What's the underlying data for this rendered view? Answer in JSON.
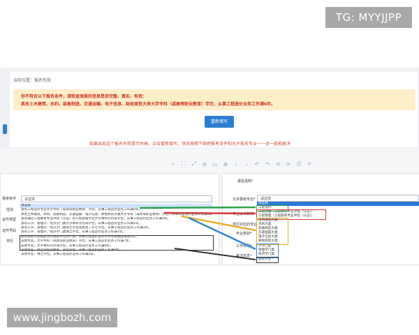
{
  "watermark_top": "TG: MYYJJPP",
  "watermark_bottom": "www.jingbozh.com",
  "breadcrumb": "当前位置：报名失败",
  "notice": {
    "line1": "你不符合以下报名条件，请检查填报的信息是否完整、真实、有效：",
    "line2": "具有土木建筑、水利、装备制造、交通运输、电子信息、财经商贸大类大学专科（或高等职业教育）学历，从事工程造价业务工作满6年。"
  },
  "refill_button": "重新填写",
  "hint": "如果出现这个报名失败提示时候，点击重新填写，然后按照下图把报考条件和允许报名专业一一对一就能解决",
  "viewer_toolbar": [
    "search-icon",
    "fit-icon",
    "expand-icon",
    "minus-icon",
    "zoom-level-icon",
    "plus-icon",
    "prev-icon",
    "next-icon",
    "undo-icon",
    "redo-icon",
    "rotate-left-icon",
    "rotate-right-icon",
    "print-icon",
    "crop-icon"
  ],
  "left_form": {
    "labels": [
      "报考条件",
      "性别",
      "证件类型",
      "证件号码",
      "学历"
    ],
    "select_value": "请选择",
    "options": [
      "请选择",
      "具有工程造价专业大学专科（或高等职业教育）学历，从事工程造价业务工作满5年。",
      "具有土木建筑、水利、装备制造、交通运输、电子信息、财经商贸大类大学专科（或高等职业教育）学历，从事工程造价业务工作满6年。",
      "具有通过工程教育专业评估（认证）的工程管理专业大学本科学历或学位，从事工程造价业务工作满4年。",
      "具有工学、管理学、经济学门类大学本科学历或学位，从事工程造价业务工作满5年。",
      "具有工学、管理学、经济学门类硕士学位或者第二学士学位，从事工程造价业务工作满3年。",
      "具有工学、管理学、经济学门类博士学位，从事工程造价业务工作满1年。",
      "具有其他专业相应学历或者学位的人员，从事工程造价业务工作年限相应增加1年。",
      "其他专业，大学专科（或高等职业教育）学历，从事工程造价业务工作满7年。",
      "其他专业，大学本科学历或学位，从事工程造价业务工作满6年。",
      "其他专业，硕士学位或者第二学士学位，从事工程造价业务工作满4年。",
      "其他专业，博士学位，从事工程造价业务工作满2年。"
    ]
  },
  "right_form": {
    "labels": [
      "报名需知*",
      "允许报考专业*",
      "专业技术职称*",
      "学历对应的专业",
      "专业类别*",
      "工作年限*",
      "备注信息*"
    ],
    "select_value": "请选择",
    "group1": [
      "请选择",
      "工程造价"
    ],
    "group2": [
      "工程管理（工程教育专业评估（认证））",
      "工程管理（工程教育专业评估（认证））"
    ],
    "group3": [
      "土木建筑大类",
      "水利大类",
      "装备制造大类",
      "交通运输大类",
      "电子信息大类",
      "财经商贸大类"
    ],
    "group4": [
      "工学门类",
      "管理学门类",
      "经济学门类"
    ],
    "group5": [
      "其他专业"
    ]
  },
  "colors": {
    "notice_bg": "#fcefc8",
    "notice_text": "#d0352b",
    "button": "#2d7dd2",
    "highlight": "#2b7bd6"
  }
}
